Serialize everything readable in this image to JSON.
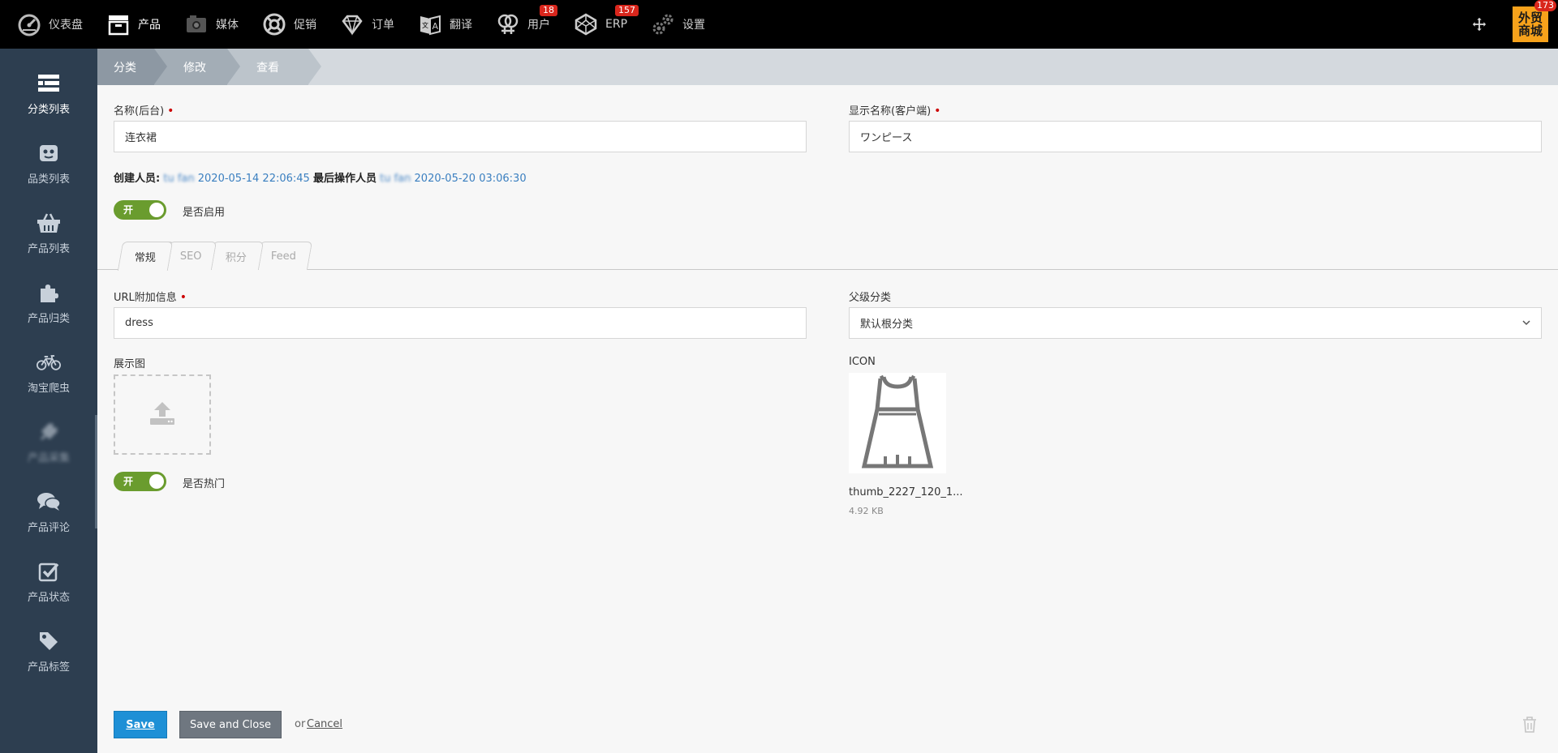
{
  "topnav": [
    {
      "label": "仪表盘",
      "icon": "dashboard-icon"
    },
    {
      "label": "产品",
      "icon": "product-icon",
      "active": true
    },
    {
      "label": "媒体",
      "icon": "media-icon"
    },
    {
      "label": "促销",
      "icon": "lifebuoy-icon"
    },
    {
      "label": "订单",
      "icon": "diamond-icon"
    },
    {
      "label": "翻译",
      "icon": "translate-icon"
    },
    {
      "label": "用户",
      "icon": "users-icon",
      "badge": "18"
    },
    {
      "label": "ERP",
      "icon": "erp-icon",
      "badge": "157"
    },
    {
      "label": "设置",
      "icon": "gears-icon"
    }
  ],
  "store": {
    "label": "外贸商城",
    "badge": "173"
  },
  "sidebar": [
    {
      "label": "分类列表",
      "icon": "list-icon",
      "active": true
    },
    {
      "label": "品类列表",
      "icon": "robot-icon"
    },
    {
      "label": "产品列表",
      "icon": "basket-icon"
    },
    {
      "label": "产品归类",
      "icon": "puzzle-icon"
    },
    {
      "label": "淘宝爬虫",
      "icon": "bicycle-icon"
    },
    {
      "label": "产品采集",
      "icon": "plug-icon",
      "blurred": true
    },
    {
      "label": "产品评论",
      "icon": "comments-icon"
    },
    {
      "label": "产品状态",
      "icon": "check-square-icon"
    },
    {
      "label": "产品标签",
      "icon": "tag-icon"
    }
  ],
  "breadcrumb": [
    "分类",
    "修改",
    "查看"
  ],
  "form": {
    "name_label": "名称(后台)",
    "name_value": "连衣裙",
    "display_label": "显示名称(客户端)",
    "display_value": "ワンピース",
    "creator_label": "创建人员:",
    "creator_name": "tu fan",
    "created_at": "2020-05-14 22:06:45",
    "modifier_label": "最后操作人员",
    "modifier_name": "tu fan",
    "modified_at": "2020-05-20 03:06:30",
    "enabled_toggle": "开",
    "enabled_label": "是否启用",
    "url_label": "URL附加信息",
    "url_value": "dress",
    "parent_label": "父级分类",
    "parent_value": "默认根分类",
    "image_label": "展示图",
    "icon_label": "ICON",
    "icon_file": "thumb_2227_120_1...",
    "icon_size": "4.92 KB",
    "hot_toggle": "开",
    "hot_label": "是否热门"
  },
  "tabs": [
    "常规",
    "SEO",
    "积分",
    "Feed"
  ],
  "footer": {
    "save": "Save",
    "save_close": "Save and Close",
    "or": "or",
    "cancel": "Cancel"
  }
}
